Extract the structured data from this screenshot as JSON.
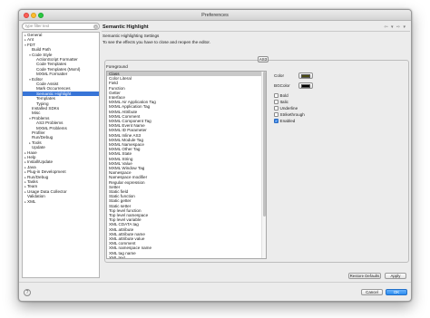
{
  "window": {
    "title": "Preferences"
  },
  "filter": {
    "placeholder": "type filter text"
  },
  "tree": [
    {
      "label": "General",
      "twisty": "▸",
      "depth": 0
    },
    {
      "label": "Ant",
      "twisty": "▸",
      "depth": 0
    },
    {
      "label": "FDT",
      "twisty": "▾",
      "depth": 0
    },
    {
      "label": "Build Path",
      "twisty": "",
      "depth": 1
    },
    {
      "label": "Code Style",
      "twisty": "▾",
      "depth": 1
    },
    {
      "label": "ActionScript Formatter",
      "twisty": "",
      "depth": 2
    },
    {
      "label": "Code Templates",
      "twisty": "",
      "depth": 2
    },
    {
      "label": "Code Templates (Mxml)",
      "twisty": "",
      "depth": 2
    },
    {
      "label": "MXML Formatter",
      "twisty": "",
      "depth": 2
    },
    {
      "label": "Editor",
      "twisty": "▾",
      "depth": 1
    },
    {
      "label": "Code Assist",
      "twisty": "",
      "depth": 2
    },
    {
      "label": "Mark Occurrences",
      "twisty": "",
      "depth": 2
    },
    {
      "label": "Semantic Highlight",
      "twisty": "",
      "depth": 2,
      "selected": true
    },
    {
      "label": "Templates",
      "twisty": "",
      "depth": 2
    },
    {
      "label": "Typing",
      "twisty": "",
      "depth": 2
    },
    {
      "label": "Installed SDKs",
      "twisty": "",
      "depth": 1
    },
    {
      "label": "Misc",
      "twisty": "",
      "depth": 1
    },
    {
      "label": "Problems",
      "twisty": "▾",
      "depth": 1
    },
    {
      "label": "AS3 Problems",
      "twisty": "",
      "depth": 2
    },
    {
      "label": "MXML Problems",
      "twisty": "",
      "depth": 2
    },
    {
      "label": "Profiler",
      "twisty": "",
      "depth": 1
    },
    {
      "label": "Run/Debug",
      "twisty": "",
      "depth": 1
    },
    {
      "label": "Tools",
      "twisty": "▸",
      "depth": 1
    },
    {
      "label": "Update",
      "twisty": "",
      "depth": 1
    },
    {
      "label": "Haxe",
      "twisty": "▸",
      "depth": 0
    },
    {
      "label": "Help",
      "twisty": "▸",
      "depth": 0
    },
    {
      "label": "Install/Update",
      "twisty": "▸",
      "depth": 0
    },
    {
      "label": "Java",
      "twisty": "▸",
      "depth": 0
    },
    {
      "label": "Plug-in Development",
      "twisty": "▸",
      "depth": 0
    },
    {
      "label": "Run/Debug",
      "twisty": "▸",
      "depth": 0
    },
    {
      "label": "Tasks",
      "twisty": "▸",
      "depth": 0
    },
    {
      "label": "Team",
      "twisty": "▸",
      "depth": 0
    },
    {
      "label": "Usage Data Collector",
      "twisty": "▸",
      "depth": 0
    },
    {
      "label": "Validation",
      "twisty": "",
      "depth": 0
    },
    {
      "label": "XML",
      "twisty": "▸",
      "depth": 0
    }
  ],
  "page": {
    "title": "Semantic Highlight",
    "nav": "⇦ ▾ ⇨ ▾",
    "section_label": "Semantic Highlighting Settings",
    "description": "To see the effects you have to close and reopen the editor.",
    "tab": "AS3",
    "foreground_label": "Foreground"
  },
  "elements": [
    "Class",
    "Color Literal",
    "Field",
    "Function",
    "Getter",
    "Interface",
    "MXML Air Application Tag",
    "MXML Application Tag",
    "MXML Attribute",
    "MXML Comment",
    "MXML Component Tag",
    "MXML Event Name",
    "MXML ID Parameter",
    "MXML Inline AS3",
    "MXML Module Tag",
    "MXML Namespace",
    "MXML Other Tag",
    "MXML State",
    "MXML String",
    "MXML Value",
    "MXML Window Tag",
    "Namespace",
    "Namespace modifier",
    "Regular expression",
    "Setter",
    "Static field",
    "Static function",
    "Static getter",
    "Static setter",
    "Top level function",
    "Top level namespace",
    "Top level variable",
    "XML CDATA tag",
    "XML attribute",
    "XML attribute name",
    "XML attribute value",
    "XML comment",
    "XML namespace name",
    "XML tag name",
    "XML text"
  ],
  "options": {
    "color_label": "Color",
    "bgcolor_label": "BGColor",
    "color_value": "#4a4a10",
    "bgcolor_value": "#000000",
    "bold": "Bold",
    "italic": "Italic",
    "underline": "Underline",
    "strikethrough": "Strikethrough",
    "enabled": "Enabled",
    "check": "✓"
  },
  "buttons": {
    "restore_defaults": "Restore Defaults",
    "apply": "Apply",
    "cancel": "Cancel",
    "ok": "OK",
    "help": "?"
  }
}
